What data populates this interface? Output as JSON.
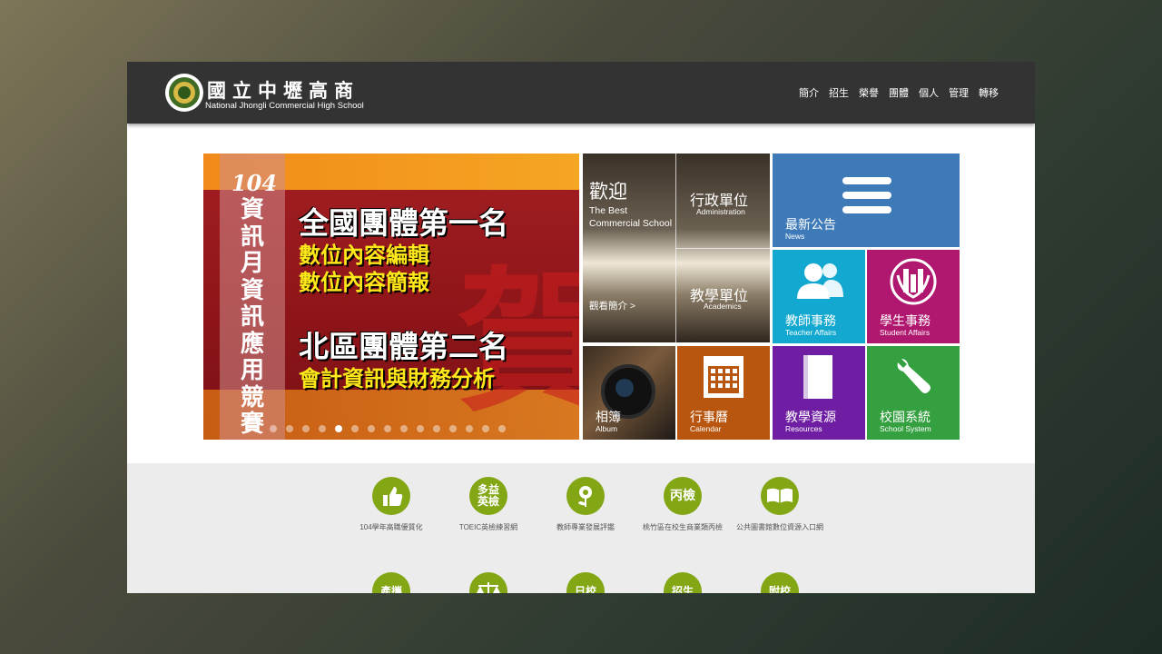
{
  "header": {
    "brand_zh": "國立中壢高商",
    "brand_en": "National Jhongli Commercial High School",
    "nav": [
      "簡介",
      "招生",
      "榮譽",
      "團體",
      "個人",
      "管理",
      "轉移"
    ]
  },
  "banner": {
    "year": "104",
    "vertical_title": "資訊月資訊應用競賽",
    "line1": "全國團體第一名",
    "line2": "數位內容編輯",
    "line3": "數位內容簡報",
    "line4": "北區團體第二名",
    "line5": "會計資訊與財務分析",
    "ghost_char": "賀",
    "dot_count": 15,
    "active_dot": 5
  },
  "welcome": {
    "title_zh": "歡迎",
    "subtitle_en_1": "The Best",
    "subtitle_en_2": "Commercial School",
    "more": "觀看簡介 >"
  },
  "tiles": {
    "admin": {
      "zh": "行政單位",
      "en": "Administration"
    },
    "academics": {
      "zh": "教學單位",
      "en": "Academics"
    },
    "news": {
      "zh": "最新公告",
      "en": "News",
      "icon": "menu-icon",
      "color": "#3e7ab8"
    },
    "teacher": {
      "zh": "教師事務",
      "en": "Teacher Affairs",
      "icon": "users-icon",
      "color": "#12a8cf"
    },
    "student": {
      "zh": "學生事務",
      "en": "Student Affairs",
      "icon": "emblem-icon",
      "color": "#b0176e"
    },
    "album": {
      "zh": "相簿",
      "en": "Album"
    },
    "calendar": {
      "zh": "行事曆",
      "en": "Calendar",
      "icon": "calendar-icon",
      "color": "#b8550e"
    },
    "resources": {
      "zh": "教學資源",
      "en": "Resources",
      "icon": "book-icon",
      "color": "#6f1ea3"
    },
    "system": {
      "zh": "校園系統",
      "en": "School System",
      "icon": "wrench-icon",
      "color": "#34a040"
    }
  },
  "quick_links": [
    {
      "icon_text": "",
      "icon": "thumbs-up-icon",
      "label": "104學年高職優質化"
    },
    {
      "icon_text": "多益英檢",
      "icon": "toeic-icon",
      "label": "TOEIC英檢練習網"
    },
    {
      "icon_text": "",
      "icon": "flower-icon",
      "label": "教師專業發展評鑑"
    },
    {
      "icon_text": "丙檢",
      "icon": "exam-icon",
      "label": "桃竹區在校生商業類丙檢"
    },
    {
      "icon_text": "",
      "icon": "open-book-icon",
      "label": "公共圖書館數位資源入口網"
    }
  ],
  "quick_links_row2": [
    {
      "icon_text": "產攜",
      "icon": "industry-icon"
    },
    {
      "icon_text": "",
      "icon": "scale-icon"
    },
    {
      "icon_text": "日校",
      "icon": "day-school-icon"
    },
    {
      "icon_text": "招生",
      "icon": "admission-icon"
    },
    {
      "icon_text": "附校",
      "icon": "affiliated-school-icon"
    }
  ]
}
